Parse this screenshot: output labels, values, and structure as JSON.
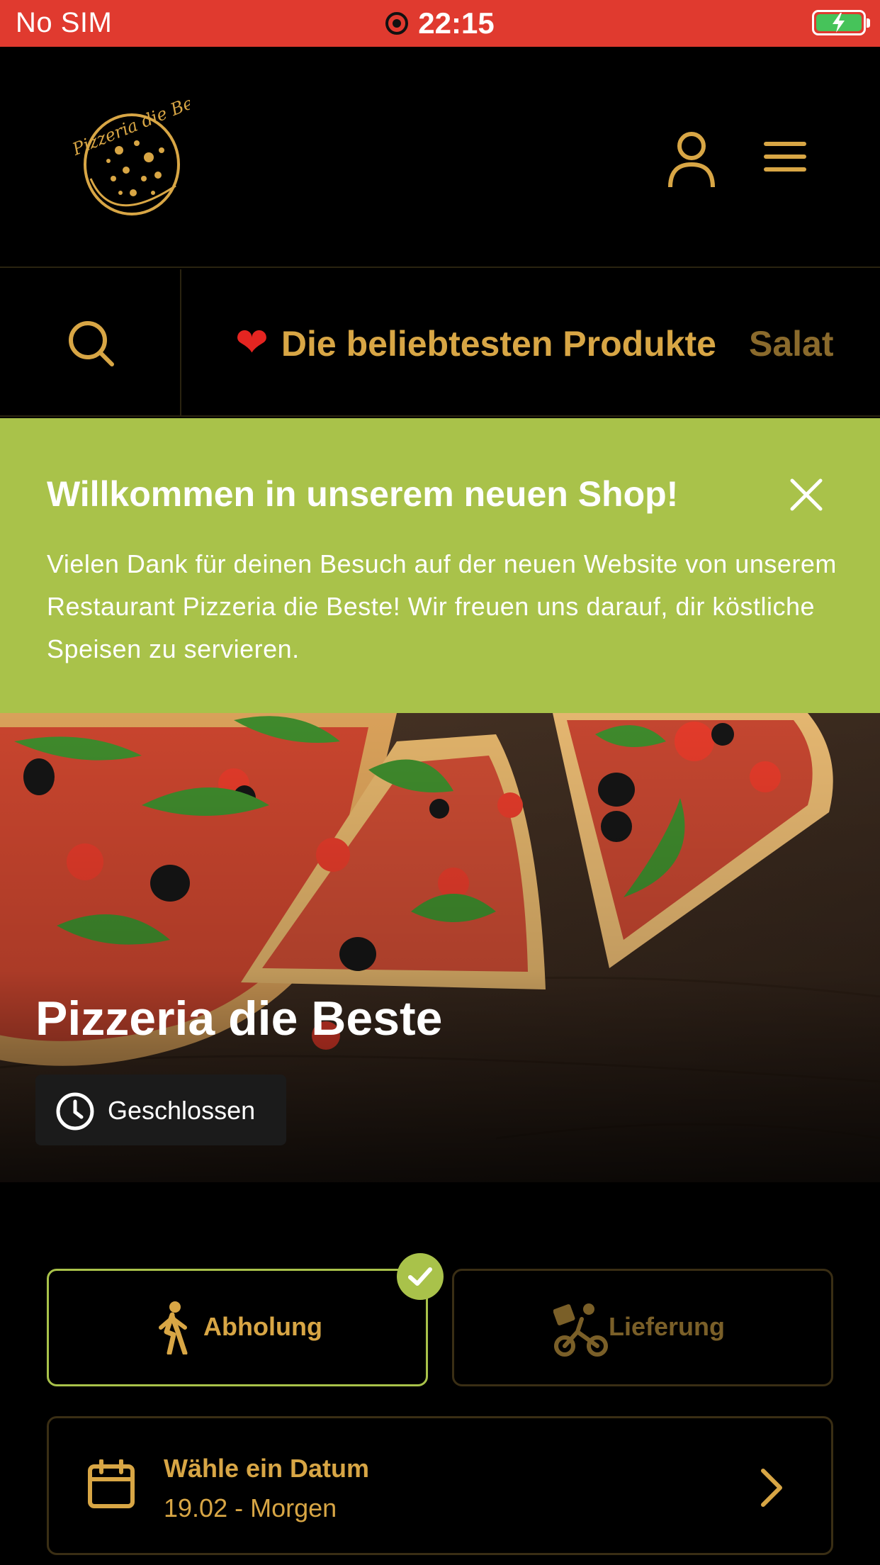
{
  "status_bar": {
    "carrier": "No SIM",
    "time": "22:15"
  },
  "header": {
    "logo_text": "Pizzeria die Beste"
  },
  "categories": [
    {
      "label": "Die beliebtesten Produkte",
      "icon": "heart-icon"
    },
    {
      "label": "Salat"
    }
  ],
  "banner": {
    "title": "Willkommen in unserem neuen Shop!",
    "text": "Vielen Dank für deinen Besuch auf der neuen Website von unserem Restaurant Pizzeria die Beste! Wir freuen uns darauf, dir köstliche Speisen zu servieren."
  },
  "hero": {
    "title": "Pizzeria die Beste",
    "status": "Geschlossen"
  },
  "order_type": {
    "pickup_label": "Abholung",
    "delivery_label": "Lieferung",
    "selected": "pickup"
  },
  "date": {
    "label": "Wähle ein Datum",
    "value": "19.02 - Morgen"
  },
  "colors": {
    "status_bar": "#e03a2f",
    "accent_gold": "#d8a645",
    "banner_green": "#a9c24a",
    "background": "#000000"
  }
}
